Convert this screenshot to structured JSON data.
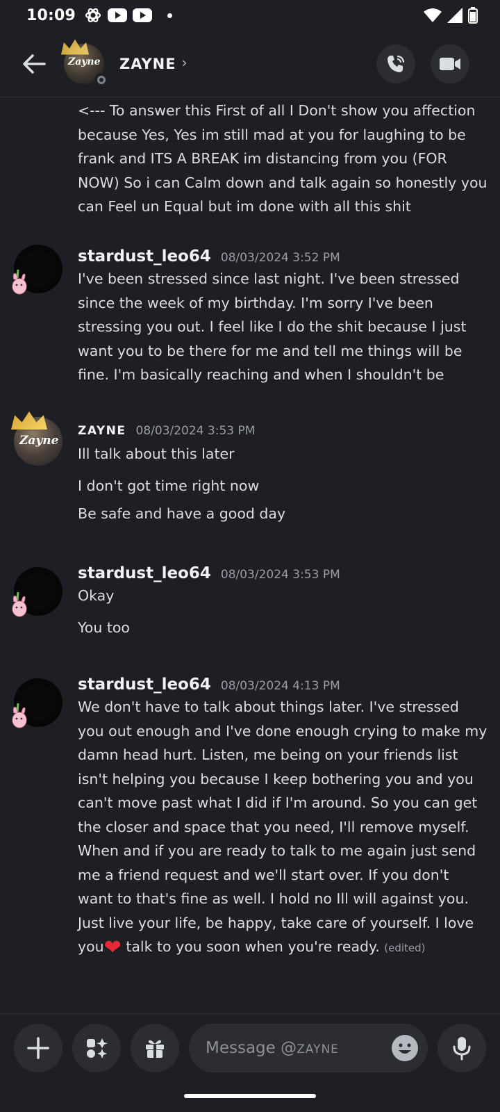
{
  "status_bar": {
    "time": "10:09"
  },
  "header": {
    "contact_name": "ZAYNE",
    "chevron": "›",
    "avatar_text": "Zayne"
  },
  "messages": [
    {
      "id": "m0",
      "continuation": true,
      "text": "<--- To answer this First of all I Don't show you affection because Yes, Yes im still mad at you for laughing to be frank and ITS A BREAK im distancing from you (FOR NOW) So i can Calm down and talk again so honestly you can Feel un Equal but im done with all this shit"
    },
    {
      "id": "m1",
      "author": "stardust_leo64",
      "timestamp": "08/03/2024 3:52 PM",
      "lines": [
        "I've been stressed since last night. I've been stressed since the week of my birthday. I'm sorry I've been stressing you out. I feel like I do the shit because I just want you to be there for me and tell me things will be fine. I'm basically reaching and when I shouldn't be"
      ]
    },
    {
      "id": "m2",
      "author": "ZAYNE",
      "timestamp": "08/03/2024 3:53 PM",
      "lines": [
        "Ill talk about this later",
        "I don't  got time right now",
        "Be safe and have a good day"
      ]
    },
    {
      "id": "m3",
      "author": "stardust_leo64",
      "timestamp": "08/03/2024 3:53 PM",
      "lines": [
        "Okay",
        "You too"
      ]
    },
    {
      "id": "m4",
      "author": "stardust_leo64",
      "timestamp": "08/03/2024 4:13 PM",
      "text_before_heart": "We don't have to talk about things later. I've stressed you out enough and I've done enough crying to make my damn head hurt. Listen, me being on your friends list isn't helping you because I keep bothering you and you can't move past what I did if I'm around. So you can get the closer and space that you need, I'll remove myself. When and if you are ready to talk to me again just send me a friend request and we'll start over. If you don't want to that's fine as well. I hold no Ill will against you. Just live your life, be happy, take care of yourself. I love you",
      "heart": "❤",
      "text_after_heart": " talk to you soon when you're ready.",
      "edited": "(edited)"
    }
  ],
  "composer": {
    "placeholder_prefix": "Message @",
    "placeholder_name": "ZAYNE"
  },
  "icons": {
    "back": "arrow-left-icon",
    "call": "phone-icon",
    "video": "video-camera-icon",
    "add": "plus-icon",
    "apps": "apps-icon",
    "gift": "gift-icon",
    "emoji": "emoji-icon",
    "mic": "microphone-icon"
  },
  "colors": {
    "background": "#1e1f24",
    "button_bg": "#2b2d31",
    "heart": "#e5283a",
    "timestamp": "#9b9ea6"
  }
}
